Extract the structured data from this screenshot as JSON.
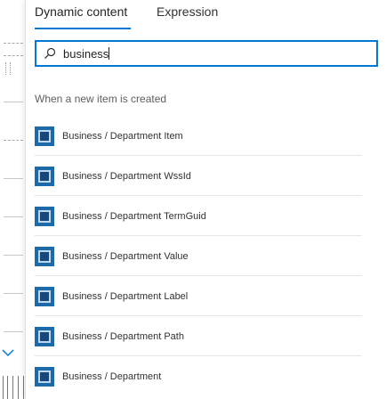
{
  "tabs": {
    "dynamic_label": "Dynamic content",
    "expression_label": "Expression"
  },
  "search": {
    "value": "business",
    "icon": "search-icon"
  },
  "section": {
    "header": "When a new item is created"
  },
  "items": [
    {
      "label": "Business / Department Item",
      "icon": "sharepoint-icon"
    },
    {
      "label": "Business / Department WssId",
      "icon": "sharepoint-icon"
    },
    {
      "label": "Business / Department TermGuid",
      "icon": "sharepoint-icon"
    },
    {
      "label": "Business / Department Value",
      "icon": "sharepoint-icon"
    },
    {
      "label": "Business / Department Label",
      "icon": "sharepoint-icon"
    },
    {
      "label": "Business / Department Path",
      "icon": "sharepoint-icon"
    },
    {
      "label": "Business / Department",
      "icon": "sharepoint-icon"
    }
  ],
  "colors": {
    "accent": "#0078d4",
    "icon_bg": "#1c6aa8"
  }
}
